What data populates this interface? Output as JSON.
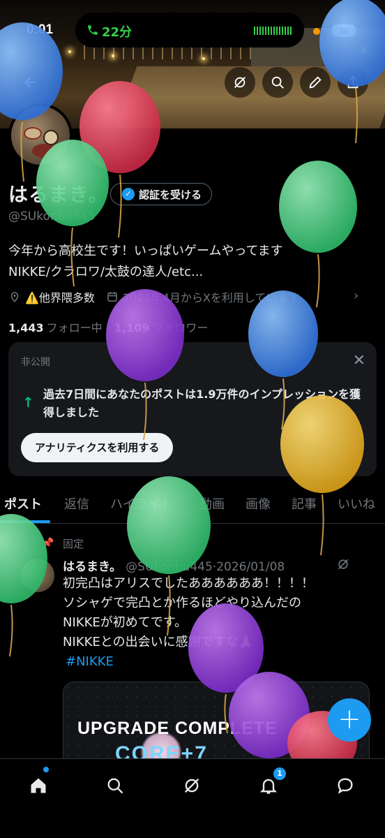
{
  "status_bar": {
    "time": "0:01",
    "call_duration": "22分",
    "battery": "30"
  },
  "profile": {
    "display_name": "はるまき。",
    "verify_label": "認証を受ける",
    "handle": "@SUkonbu445",
    "bio_lines": [
      "今年から高校生です！いっぱいゲームやってます",
      "NIKKE/クラロワ/太鼓の達人/etc..."
    ],
    "location": "⚠️他界隈多数",
    "joined": "2024年4月からXを利用しています",
    "following_count": "1,443",
    "following_label": "フォロー中",
    "followers_count": "1,109",
    "followers_label": "フォロワー"
  },
  "private_card": {
    "label": "非公開",
    "message": "過去7日間にあなたのポストは1.9万件のインプレッションを獲得しました",
    "button": "アナリティクスを利用する"
  },
  "tabs": [
    {
      "label": "ポスト",
      "active": true
    },
    {
      "label": "返信"
    },
    {
      "label": "ハイライト"
    },
    {
      "label": "動画"
    },
    {
      "label": "画像"
    },
    {
      "label": "記事"
    },
    {
      "label": "いいね"
    }
  ],
  "post": {
    "pinned_label": "固定",
    "name": "はるまき。",
    "handle_date": "@SUkonbu445·2026/01/08",
    "body_lines": [
      "初完凸はアリスでしたああああああ！！！！",
      "ソシャゲで完凸とか作るほどやり込んだの",
      "NIKKEが初めてです。",
      "NIKKEとの出会いに感謝ですな🙏"
    ],
    "hashtag": "#NIKKE",
    "media_title": "UPGRADE COMPLETE",
    "media_sub": "CORE+7"
  },
  "bottom_nav": {
    "notification_count": "1"
  },
  "colors": {
    "accent": "#1d9bf0",
    "call_green": "#35d14c",
    "up_green": "#00ba7c"
  },
  "icons": [
    "phone-icon",
    "back-arrow-icon",
    "grok-icon",
    "search-icon",
    "edit-icon",
    "share-icon",
    "verified-badge-icon",
    "location-icon",
    "calendar-icon",
    "close-icon",
    "arrow-up-icon",
    "pin-icon",
    "plus-icon",
    "home-icon",
    "bell-icon",
    "messages-icon",
    "balloon-icon"
  ]
}
